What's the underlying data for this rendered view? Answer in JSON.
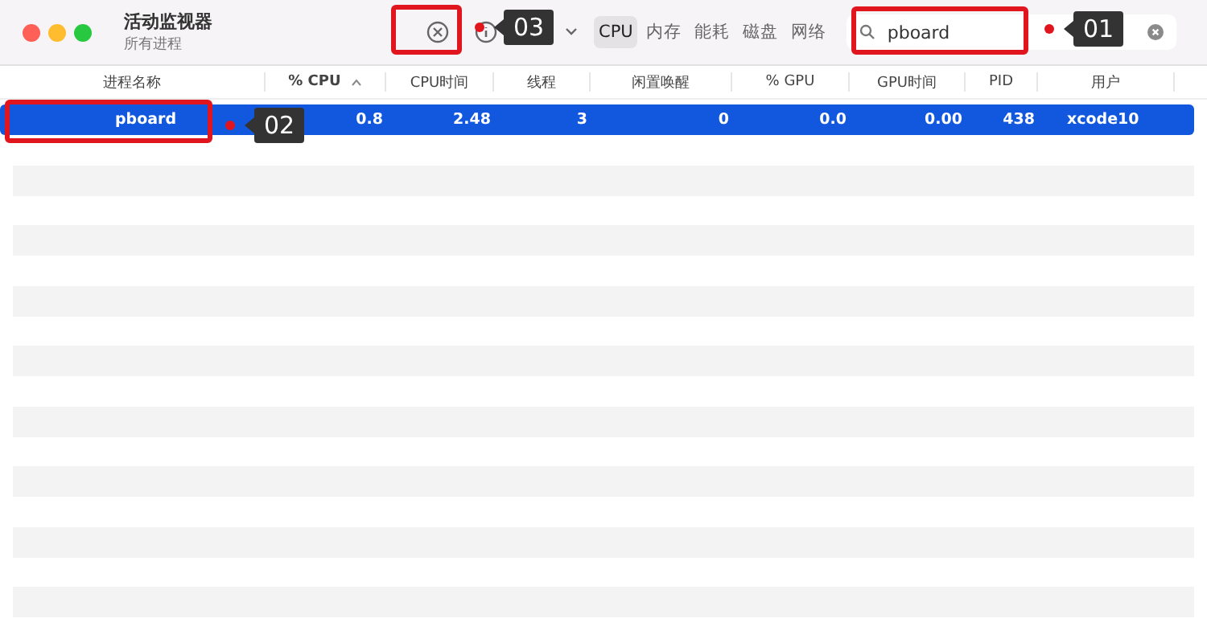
{
  "window": {
    "title": "活动监视器",
    "subtitle": "所有进程"
  },
  "tabs": [
    {
      "label": "CPU",
      "selected": true
    },
    {
      "label": "内存",
      "selected": false
    },
    {
      "label": "能耗",
      "selected": false
    },
    {
      "label": "磁盘",
      "selected": false
    },
    {
      "label": "网络",
      "selected": false
    }
  ],
  "search": {
    "value": "pboard"
  },
  "table": {
    "columns": [
      {
        "label": "进程名称",
        "sorted": false
      },
      {
        "label": "% CPU",
        "sorted": true
      },
      {
        "label": "CPU时间",
        "sorted": false
      },
      {
        "label": "线程",
        "sorted": false
      },
      {
        "label": "闲置唤醒",
        "sorted": false
      },
      {
        "label": "% GPU",
        "sorted": false
      },
      {
        "label": "GPU时间",
        "sorted": false
      },
      {
        "label": "PID",
        "sorted": false
      },
      {
        "label": "用户",
        "sorted": false
      }
    ],
    "rows": [
      {
        "selected": true,
        "cells": [
          "pboard",
          "0.8",
          "2.48",
          "3",
          "0",
          "0.0",
          "0.00",
          "438",
          "xcode10"
        ]
      }
    ]
  },
  "annotations": [
    {
      "label": "03"
    },
    {
      "label": "02"
    },
    {
      "label": "01"
    }
  ]
}
